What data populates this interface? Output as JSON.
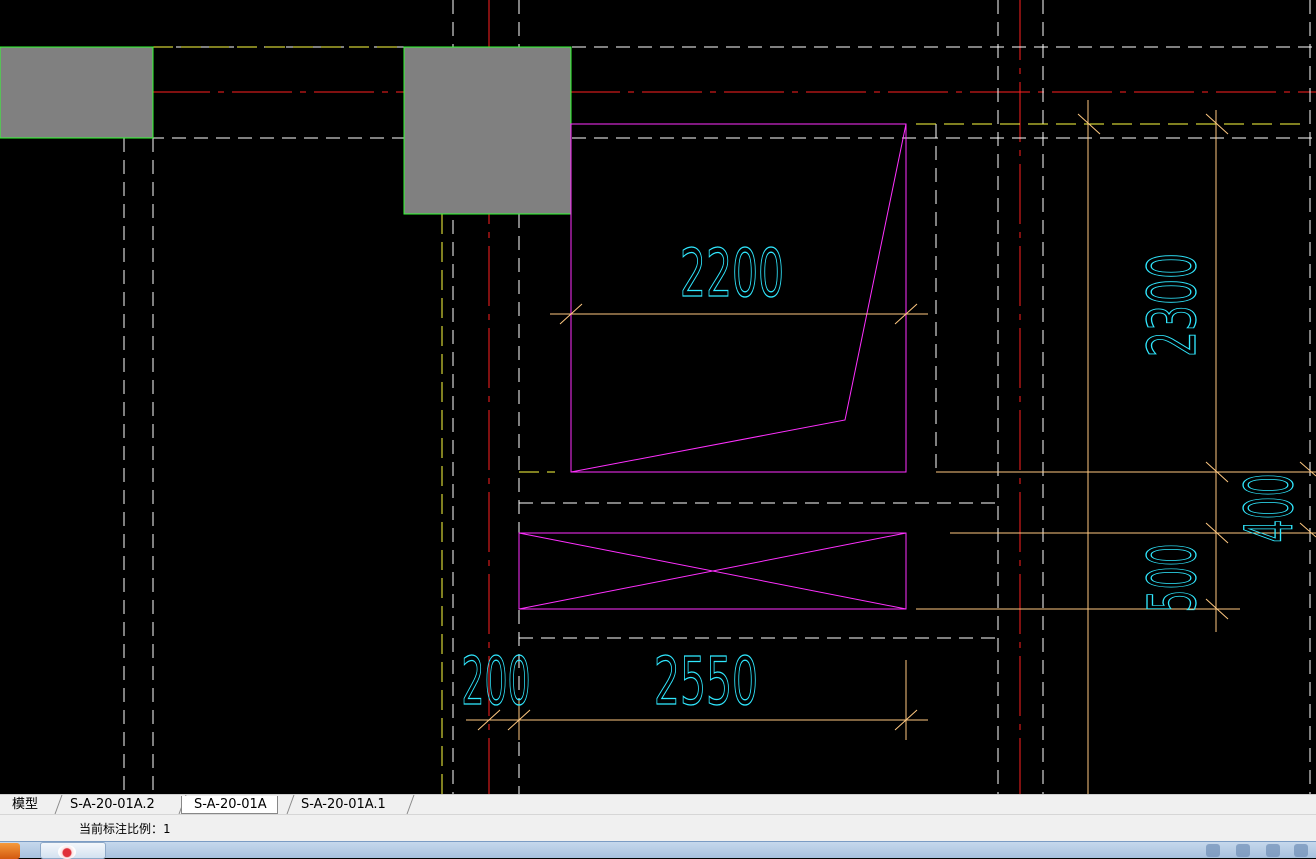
{
  "drawing": {
    "dimensions": {
      "width_top": "2200",
      "width_bottom": "2550",
      "offset_left": "200",
      "height_right": "2300",
      "gap_right": "400",
      "opening_height": "500"
    },
    "colors": {
      "background": "#000000",
      "axis_line": "#ff2020",
      "dashed_wall": "#ffffff",
      "yellow_dash": "#ffff40",
      "column_fill": "#808080",
      "column_edge": "#30ff30",
      "opening": "#ff30ff",
      "dimension_line": "#ffc880",
      "dimension_text": "#30e8ff"
    }
  },
  "layout_tabs": [
    {
      "label": "模型"
    },
    {
      "label": "S-A-20-01A.2"
    },
    {
      "label": "S-A-20-01A"
    },
    {
      "label": "S-A-20-01A.1"
    }
  ],
  "active_tab": "S-A-20-01A",
  "statusbar": {
    "scale_text": "当前标注比例：1"
  },
  "taskbar": {
    "start_icon": "start-icon",
    "app_icon": "cad-app-icon"
  }
}
